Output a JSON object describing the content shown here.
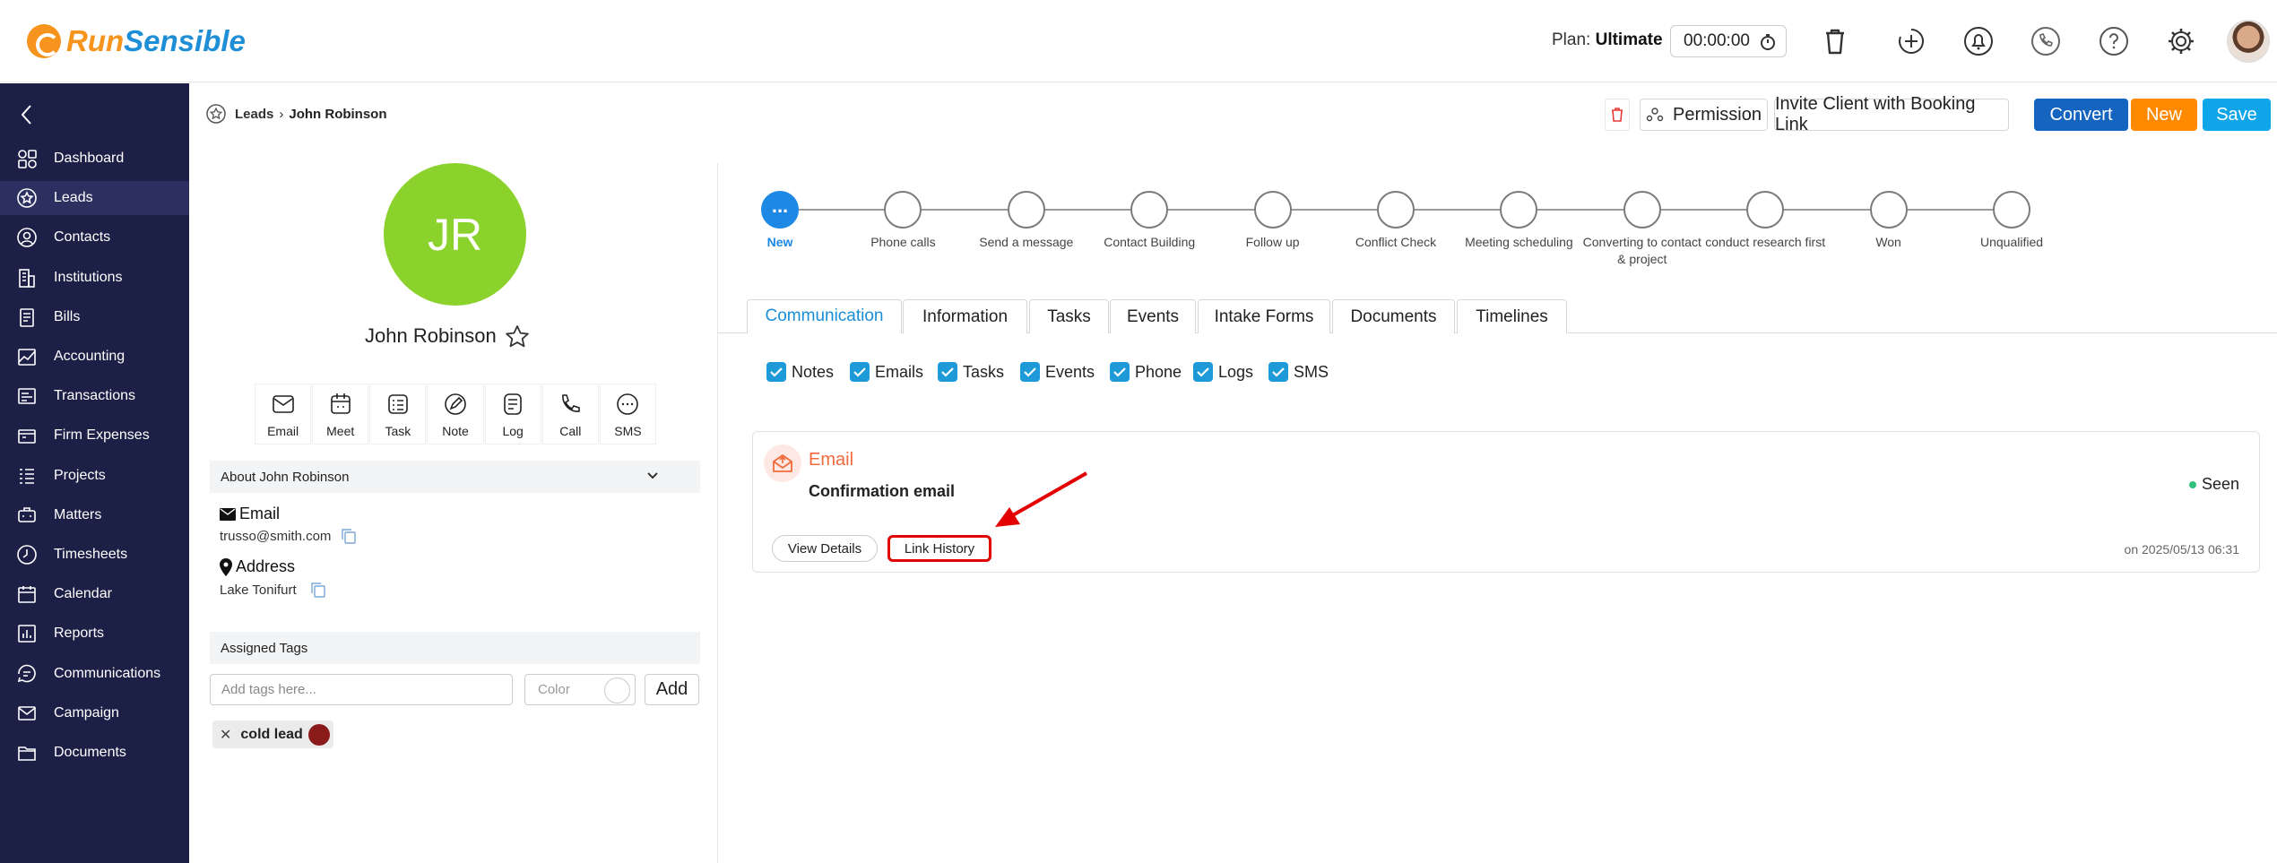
{
  "brand": {
    "name_part1": "Run",
    "name_part2": "Sensible",
    "orange": "#f7941d",
    "blue": "#1e8fd6"
  },
  "header": {
    "plan_label": "Plan:",
    "plan_value": "Ultimate",
    "timer": "00:00:00",
    "icons": [
      "trash-icon",
      "add-icon",
      "bell-icon",
      "phone-icon",
      "help-icon",
      "settings-icon",
      "avatar"
    ]
  },
  "sidebar": {
    "bg": "#1c1f46",
    "items": [
      {
        "label": "Dashboard",
        "icon": "dashboard-icon"
      },
      {
        "label": "Leads",
        "icon": "star-icon",
        "active": true
      },
      {
        "label": "Contacts",
        "icon": "contacts-icon"
      },
      {
        "label": "Institutions",
        "icon": "building-icon"
      },
      {
        "label": "Bills",
        "icon": "bill-icon"
      },
      {
        "label": "Accounting",
        "icon": "accounting-icon"
      },
      {
        "label": "Transactions",
        "icon": "transactions-icon"
      },
      {
        "label": "Firm Expenses",
        "icon": "expenses-icon"
      },
      {
        "label": "Projects",
        "icon": "projects-icon"
      },
      {
        "label": "Matters",
        "icon": "matters-icon"
      },
      {
        "label": "Timesheets",
        "icon": "clock-icon"
      },
      {
        "label": "Calendar",
        "icon": "calendar-icon"
      },
      {
        "label": "Reports",
        "icon": "reports-icon"
      },
      {
        "label": "Communications",
        "icon": "communications-icon"
      },
      {
        "label": "Campaign",
        "icon": "mail-icon"
      },
      {
        "label": "Documents",
        "icon": "folder-icon"
      }
    ]
  },
  "breadcrumb": {
    "section": "Leads",
    "current": "John Robinson"
  },
  "actions": {
    "permission": "Permission",
    "invite": "Invite Client with Booking Link",
    "convert": "Convert",
    "new": "New",
    "save": "Save"
  },
  "profile": {
    "initials": "JR",
    "avatar_color": "#8bd22d",
    "name": "John Robinson",
    "quick_actions": [
      "Email",
      "Meet",
      "Task",
      "Note",
      "Log",
      "Call",
      "SMS"
    ],
    "about_title": "About John Robinson",
    "email_label": "Email",
    "email_value": "trusso@smith.com",
    "address_label": "Address",
    "address_value": "Lake Tonifurt",
    "tags_title": "Assigned Tags",
    "tag_placeholder": "Add tags here...",
    "color_label": "Color",
    "add_label": "Add",
    "tags": [
      {
        "label": "cold lead",
        "color": "#8b1a1a"
      }
    ]
  },
  "pipeline": {
    "stages": [
      {
        "label": "New",
        "active": true,
        "symbol": "..."
      },
      {
        "label": "Phone calls"
      },
      {
        "label": "Send a message"
      },
      {
        "label": "Contact Building"
      },
      {
        "label": "Follow up"
      },
      {
        "label": "Conflict Check"
      },
      {
        "label": "Meeting scheduling"
      },
      {
        "label": "Converting to contact & project"
      },
      {
        "label": "conduct research first"
      },
      {
        "label": "Won"
      },
      {
        "label": "Unqualified"
      }
    ]
  },
  "tabs": [
    "Communication",
    "Information",
    "Tasks",
    "Events",
    "Intake Forms",
    "Documents",
    "Timelines"
  ],
  "active_tab": "Communication",
  "filters": [
    "Notes",
    "Emails",
    "Tasks",
    "Events",
    "Phone",
    "Logs",
    "SMS"
  ],
  "communication_item": {
    "type": "Email",
    "title": "Confirmation email",
    "status": "Seen",
    "view_details": "View Details",
    "link_history": "Link History",
    "date": "on 2025/05/13 06:31"
  }
}
